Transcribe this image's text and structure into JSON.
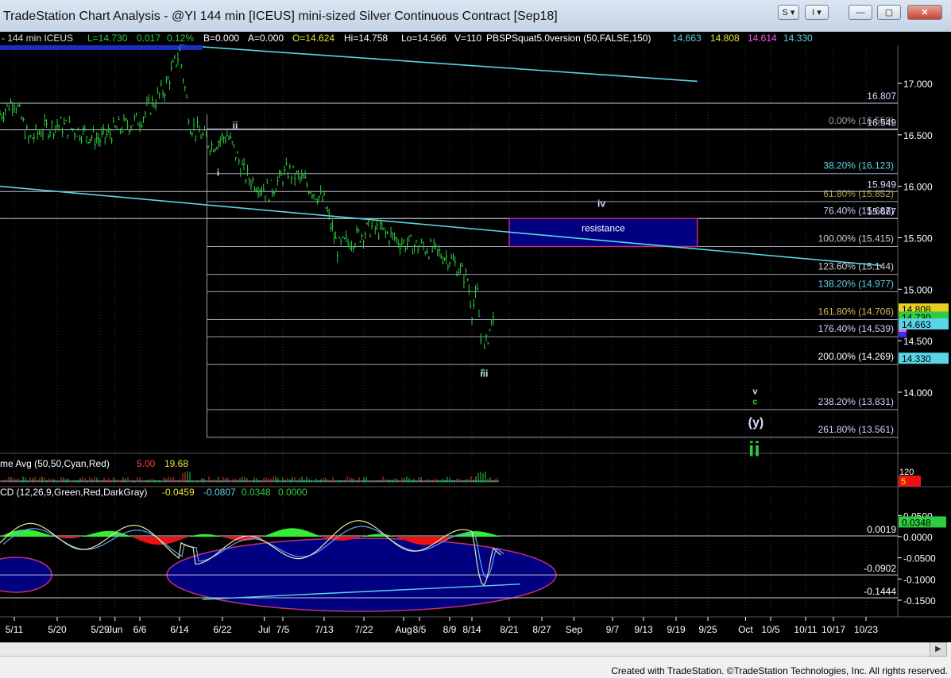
{
  "window": {
    "title": "TradeStation Chart Analysis - @YI 144 min [ICEUS] mini-sized Silver Continuous Contract [Sep18]",
    "btn_s": "S",
    "btn_i": "I",
    "btn_min": "—",
    "btn_max": "▢",
    "btn_close": "✕"
  },
  "info_line": {
    "symbol": "- 144 min  ICEUS",
    "last": "L=14.730",
    "change": "0.017",
    "pct": "0.12%",
    "bid": "B=0.000",
    "ask": "A=0.000",
    "open": "O=14.624",
    "high": "Hi=14.758",
    "low": "Lo=14.566",
    "volume": "V=110",
    "study": "PBSPSquat5.0version (50,FALSE,150)",
    "v1": "14.663",
    "v2": "14.808",
    "v3": "14.614",
    "v4": "14.330"
  },
  "volume_panel": {
    "label": "me Avg (50,50,Cyan,Red)",
    "v1": "5.00",
    "v2": "19.68",
    "axis_label": "120",
    "red_tag": "5"
  },
  "macd_panel": {
    "label": "CD (12,26,9,Green,Red,DarkGray)",
    "v1": "-0.0459",
    "v2": "-0.0807",
    "v3": "0.0348",
    "v4": "0.0000",
    "axis_ticks": [
      "0.0500",
      "0.0000",
      "-0.0500",
      "-0.1000",
      "-0.1500"
    ],
    "axis_tag": "0.0348",
    "line_labels": [
      "0.0019",
      "-0.0902",
      "-0.1444"
    ]
  },
  "price_axis": {
    "ticks": [
      "17.000",
      "16.500",
      "16.000",
      "15.500",
      "15.000",
      "14.500",
      "14.000"
    ],
    "tags": [
      "14.808",
      "14.730",
      "14.663",
      "14.330"
    ]
  },
  "levels": {
    "right_values": [
      "16.807",
      "16.549",
      "15.949",
      "15.687"
    ],
    "fib": [
      "0.00% (16.559)",
      "38.20% (16.123)",
      "61.80% (15.852)",
      "76.40% (15.687)",
      "100.00% (15.415)",
      "123.60% (15.144)",
      "138.20% (14.977)",
      "161.80% (14.706)",
      "176.40% (14.539)",
      "200.00% (14.269)",
      "238.20% (13.831)",
      "261.80% (13.561)"
    ]
  },
  "annotations": {
    "resistance": "resistance",
    "wave_ii_small": "ii",
    "wave_i": "i",
    "wave_iii": "iii",
    "wave_iv": "iv",
    "wave_v": "v",
    "wave_c": "c",
    "wave_y": "(y)",
    "wave_ii_big": "ii"
  },
  "time_axis": [
    "5/11",
    "5/20",
    "5/29",
    "Jun",
    "6/6",
    "6/14",
    "6/22",
    "Jul",
    "7/5",
    "7/13",
    "7/22",
    "Aug",
    "8/5",
    "8/9",
    "8/14",
    "8/21",
    "8/27",
    "Sep",
    "9/7",
    "9/13",
    "9/19",
    "9/25",
    "Oct",
    "10/5",
    "10/11",
    "10/17",
    "10/23"
  ],
  "footer": "Created with TradeStation. ©TradeStation Technologies, Inc. All rights reserved.",
  "colors": {
    "background": "#000000",
    "price": "#2ecc40",
    "cyan": "#5ad4e6",
    "resistance_fill": "#000080",
    "resistance_border": "#c0307a",
    "macd_hist_pos": "#33ee33",
    "macd_hist_neg": "#ee1111",
    "macd_line": "#e8e8a0",
    "signal_line": "#5aa8ff",
    "axis_text": "#ffffff"
  },
  "chart_data": {
    "type": "line",
    "title": "TradeStation Chart Analysis - @YI 144 min [ICEUS] mini-sized Silver Continuous Contract [Sep18]",
    "x_tick_labels": [
      "5/11",
      "5/20",
      "5/29",
      "Jun",
      "6/6",
      "6/14",
      "6/22",
      "Jul",
      "7/5",
      "7/13",
      "7/22",
      "Aug",
      "8/5",
      "8/9",
      "8/14",
      "8/21",
      "8/27",
      "Sep",
      "9/7",
      "9/13",
      "9/19",
      "9/25",
      "Oct",
      "10/5",
      "10/11",
      "10/17",
      "10/23"
    ],
    "ylim": [
      13.35,
      17.35
    ],
    "y_ticks": [
      14.0,
      14.5,
      15.0,
      15.5,
      16.0,
      16.5,
      17.0
    ],
    "series": [
      {
        "name": "@YI 144 min",
        "points": [
          [
            "5/08",
            16.7
          ],
          [
            "5/11",
            16.85
          ],
          [
            "5/14",
            16.45
          ],
          [
            "5/17",
            16.55
          ],
          [
            "5/20",
            16.6
          ],
          [
            "5/24",
            16.55
          ],
          [
            "5/29",
            16.45
          ],
          [
            "6/01",
            16.55
          ],
          [
            "6/06",
            16.65
          ],
          [
            "6/11",
            16.95
          ],
          [
            "6/14",
            17.3
          ],
          [
            "6/16",
            16.6
          ],
          [
            "6/20",
            16.4
          ],
          [
            "6/23",
            16.5
          ],
          [
            "6/27",
            16.1
          ],
          [
            "7/02",
            15.95
          ],
          [
            "7/06",
            16.15
          ],
          [
            "7/09",
            16.05
          ],
          [
            "7/13",
            15.85
          ],
          [
            "7/16",
            15.4
          ],
          [
            "7/20",
            15.5
          ],
          [
            "7/24",
            15.6
          ],
          [
            "7/27",
            15.55
          ],
          [
            "8/01",
            15.45
          ],
          [
            "8/06",
            15.4
          ],
          [
            "8/09",
            15.3
          ],
          [
            "8/13",
            15.1
          ],
          [
            "8/14",
            14.8
          ],
          [
            "8/15",
            14.95
          ],
          [
            "8/16",
            14.3
          ],
          [
            "8/17",
            14.55
          ],
          [
            "8/18",
            14.73
          ]
        ]
      }
    ],
    "fib_levels": [
      {
        "label": "0.00%",
        "value": 16.559
      },
      {
        "label": "38.20%",
        "value": 16.123
      },
      {
        "label": "61.80%",
        "value": 15.852
      },
      {
        "label": "76.40%",
        "value": 15.687
      },
      {
        "label": "100.00%",
        "value": 15.415
      },
      {
        "label": "123.60%",
        "value": 15.144
      },
      {
        "label": "138.20%",
        "value": 14.977
      },
      {
        "label": "161.80%",
        "value": 14.706
      },
      {
        "label": "176.40%",
        "value": 14.539
      },
      {
        "label": "200.00%",
        "value": 14.269
      },
      {
        "label": "238.20%",
        "value": 13.831
      },
      {
        "label": "261.80%",
        "value": 13.561
      }
    ],
    "horizontal_levels": [
      16.807,
      16.549,
      15.949,
      15.687
    ],
    "resistance_zone": {
      "top": 15.687,
      "bottom": 15.415,
      "from": "8/21",
      "to": "9/23"
    },
    "trendlines": [
      {
        "from": [
          "6/14",
          17.37
        ],
        "to": [
          "9/23",
          17.02
        ]
      },
      {
        "from": [
          "5/08",
          16.0
        ],
        "to": [
          "10/25",
          15.23
        ]
      }
    ],
    "macd": {
      "params": "12,26,9",
      "values": {
        "macd": -0.0459,
        "signal": -0.0807,
        "histogram": 0.0348
      },
      "levels": [
        0.0019,
        -0.0902,
        -0.1444
      ],
      "ylim": [
        -0.175,
        0.07
      ]
    },
    "grid": true,
    "legend": "top"
  }
}
